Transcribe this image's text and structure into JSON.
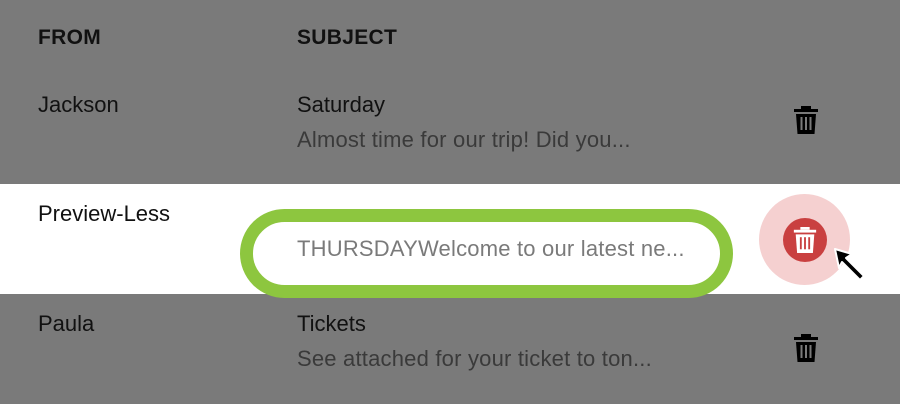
{
  "header": {
    "from_label": "FROM",
    "subject_label": "SUBJECT"
  },
  "rows": [
    {
      "from": "Jackson",
      "subject": "Saturday",
      "preview": "Almost time for our trip! Did you..."
    },
    {
      "from": "Preview-Less",
      "subject": "",
      "preview": "THURSDAYWelcome to our latest ne..."
    },
    {
      "from": "Paula",
      "subject": "Tickets",
      "preview": "See attached for your ticket to ton..."
    }
  ],
  "icons": {
    "trash": "trash-icon",
    "cursor": "mouse-pointer-icon"
  },
  "colors": {
    "overlay_gray": "#7a7a7a",
    "highlight_row": "#ffffff",
    "callout_green": "#8dc63f",
    "delete_red": "#c94040",
    "delete_halo": "#f5d0d0"
  }
}
